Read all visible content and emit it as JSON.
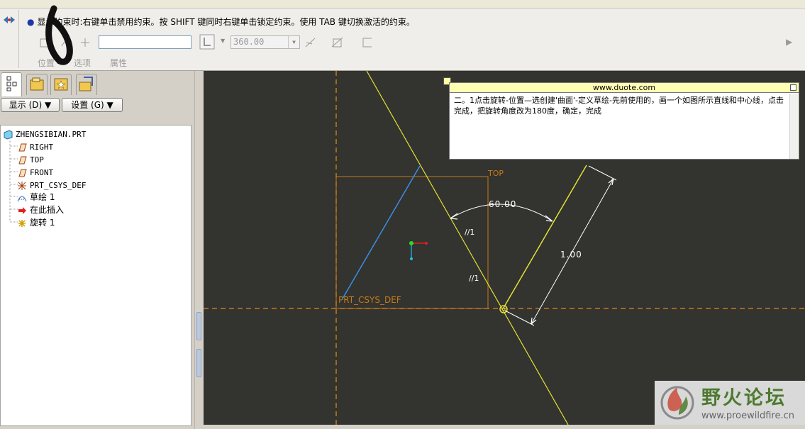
{
  "dashboard": {
    "message": "显示约束时:右键单击禁用约束。按 SHIFT 键同时右键单击锁定约束。使用 TAB 键切换激活的约束。",
    "text_field_value": "",
    "angle_value": "360.00",
    "tabs": [
      "位置",
      "选项",
      "属性"
    ]
  },
  "panel": {
    "show_button": "显示 (D) ▼",
    "settings_button": "设置 (G) ▼"
  },
  "tree": {
    "root": "ZHENGSIBIAN.PRT",
    "items": [
      "RIGHT",
      "TOP",
      "FRONT",
      "PRT_CSYS_DEF",
      "草绘 1",
      "在此插入",
      "旋转 1"
    ]
  },
  "sketch": {
    "top_label": "TOP",
    "csys_label": "PRT_CSYS_DEF",
    "angle_dim": "60.00",
    "length_dim": "1.00",
    "parallel_mark_1": "//1",
    "parallel_mark_2": "//1"
  },
  "note": {
    "title": "www.duote.com",
    "body": "二。1点击旋转-位置—选创建'曲面'-定义草绘-先前使用的，画一个如图所示直线和中心线，点击完成，把旋转角度改为180度，确定，完成"
  },
  "watermark": {
    "name": "野火论坛",
    "url": "www.proewildfire.cn"
  },
  "colors": {
    "canvas_bg": "#33332f",
    "datum_orange": "#c47a1a",
    "geometry_yellow": "#e2e236",
    "sketch_blue": "#3a8fe0",
    "note_title_bg": "#ffffb4"
  }
}
